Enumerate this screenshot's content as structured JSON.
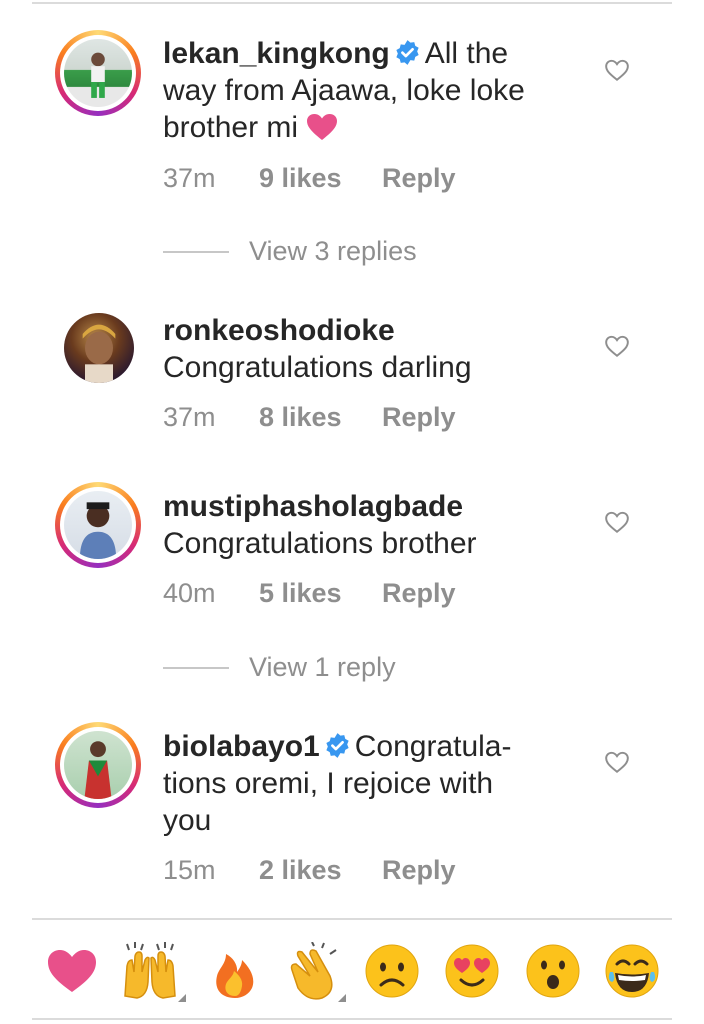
{
  "comments": [
    {
      "username": "lekan_kingkong",
      "verified": true,
      "body_lines": [
        "All the",
        "way from Ajaawa, loke loke",
        "brother mi"
      ],
      "trailing_emoji": "pink-heart",
      "time": "37m",
      "likes": "9 likes",
      "reply": "Reply",
      "view_replies": "View 3 replies"
    },
    {
      "username": "ronkeoshodioke",
      "verified": false,
      "body": "Congratulations darling",
      "time": "37m",
      "likes": "8 likes",
      "reply": "Reply"
    },
    {
      "username": "mustiphasholagbade",
      "verified": false,
      "body": "Congratulations brother",
      "time": "40m",
      "likes": "5 likes",
      "reply": "Reply",
      "view_replies": "View 1 reply"
    },
    {
      "username": "biolabayo1",
      "verified": true,
      "body_lines": [
        "Congratula-",
        "tions oremi, I rejoice with",
        "you"
      ],
      "time": "15m",
      "likes": "2 likes",
      "reply": "Reply"
    }
  ],
  "emoji_bar": [
    "heart",
    "raised-hands",
    "fire",
    "clapping-hands",
    "frowning-face",
    "heart-eyes-face",
    "surprised-face",
    "laughing-face"
  ],
  "colors": {
    "verified_blue": "#3897f0",
    "meta_gray": "#8e8e8e",
    "pink_heart": "#e8508a"
  }
}
